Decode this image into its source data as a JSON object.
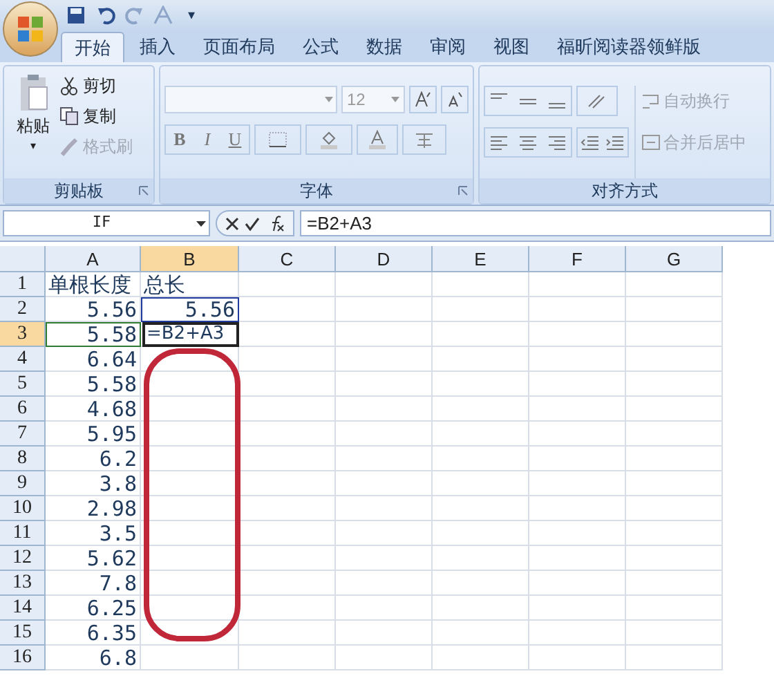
{
  "quick_access": {
    "menu_arrow": "▾"
  },
  "tabs": [
    {
      "label": "开始",
      "selected": true
    },
    {
      "label": "插入",
      "selected": false
    },
    {
      "label": "页面布局",
      "selected": false
    },
    {
      "label": "公式",
      "selected": false
    },
    {
      "label": "数据",
      "selected": false
    },
    {
      "label": "审阅",
      "selected": false
    },
    {
      "label": "视图",
      "selected": false
    },
    {
      "label": "福昕阅读器领鲜版",
      "selected": false
    }
  ],
  "ribbon": {
    "clipboard": {
      "title": "剪贴板",
      "paste": "粘贴",
      "paste_arrow": "▾",
      "cut": "剪切",
      "copy": "复制",
      "format_painter": "格式刷",
      "format_painter_disabled": true
    },
    "font": {
      "title": "字体",
      "font_size": "12",
      "style_buttons": [
        "B",
        "I",
        "U"
      ]
    },
    "alignment": {
      "title": "对齐方式",
      "wrap_text": "自动换行",
      "merge_center": "合并后居中",
      "disabled": true
    }
  },
  "formula_bar": {
    "name_box": "IF",
    "formula": "=B2+A3"
  },
  "columns": [
    {
      "label": "A",
      "selected": false
    },
    {
      "label": "B",
      "selected": true
    },
    {
      "label": "C",
      "selected": false
    },
    {
      "label": "D",
      "selected": false
    },
    {
      "label": "E",
      "selected": false
    },
    {
      "label": "F",
      "selected": false
    },
    {
      "label": "G",
      "selected": false
    }
  ],
  "rows": [
    {
      "number": "1",
      "selected": false,
      "cells": [
        {
          "text": "单根长度",
          "kind": "text"
        },
        {
          "text": "总长",
          "kind": "text"
        }
      ]
    },
    {
      "number": "2",
      "selected": false,
      "cells": [
        {
          "text": "5.56",
          "kind": "number"
        },
        {
          "text": "5.56",
          "kind": "number",
          "color": "#1f3c9c"
        }
      ]
    },
    {
      "number": "3",
      "selected": true,
      "cells": [
        {
          "text": "5.58",
          "kind": "number",
          "color": "#2e7d32"
        },
        {
          "text": "=B2+A3",
          "kind": "editing"
        }
      ]
    },
    {
      "number": "4",
      "selected": false,
      "cells": [
        {
          "text": "6.64",
          "kind": "number"
        }
      ]
    },
    {
      "number": "5",
      "selected": false,
      "cells": [
        {
          "text": "5.58",
          "kind": "number"
        }
      ]
    },
    {
      "number": "6",
      "selected": false,
      "cells": [
        {
          "text": "4.68",
          "kind": "number"
        }
      ]
    },
    {
      "number": "7",
      "selected": false,
      "cells": [
        {
          "text": "5.95",
          "kind": "number"
        }
      ]
    },
    {
      "number": "8",
      "selected": false,
      "cells": [
        {
          "text": "6.2",
          "kind": "number"
        }
      ]
    },
    {
      "number": "9",
      "selected": false,
      "cells": [
        {
          "text": "3.8",
          "kind": "number"
        }
      ]
    },
    {
      "number": "10",
      "selected": false,
      "cells": [
        {
          "text": "2.98",
          "kind": "number"
        }
      ]
    },
    {
      "number": "11",
      "selected": false,
      "cells": [
        {
          "text": "3.5",
          "kind": "number"
        }
      ]
    },
    {
      "number": "12",
      "selected": false,
      "cells": [
        {
          "text": "5.62",
          "kind": "number"
        }
      ]
    },
    {
      "number": "13",
      "selected": false,
      "cells": [
        {
          "text": "7.8",
          "kind": "number"
        }
      ]
    },
    {
      "number": "14",
      "selected": false,
      "cells": [
        {
          "text": "6.25",
          "kind": "number"
        }
      ]
    },
    {
      "number": "15",
      "selected": false,
      "cells": [
        {
          "text": "6.35",
          "kind": "number"
        }
      ]
    },
    {
      "number": "16",
      "selected": false,
      "cells": [
        {
          "text": "6.8",
          "kind": "number"
        }
      ]
    }
  ]
}
